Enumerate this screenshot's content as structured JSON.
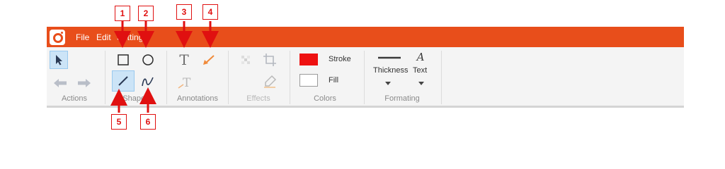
{
  "titlebar": {
    "menu": [
      "File",
      "Edit",
      "Settings"
    ]
  },
  "groups": {
    "actions": "Actions",
    "shapes": "Shapes",
    "annotations": "Annotations",
    "effects": "Effects",
    "colors": "Colors",
    "formating": "Formating"
  },
  "colors": {
    "stroke_label": "Stroke",
    "fill_label": "Fill",
    "stroke_color": "#ee1111",
    "fill_color": "#ffffff",
    "titlebar_color": "#e84e1b"
  },
  "formating": {
    "thickness_label": "Thickness",
    "text_label": "Text"
  },
  "callouts": [
    "1",
    "2",
    "3",
    "4",
    "5",
    "6"
  ]
}
